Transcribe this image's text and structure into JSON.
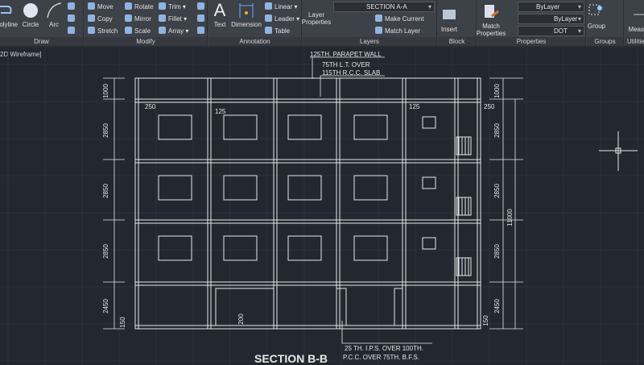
{
  "ribbon": {
    "draw": {
      "label": "Draw",
      "polyline": "Polyline",
      "circle": "Circle",
      "arc": "Arc"
    },
    "modify": {
      "label": "Modify",
      "move": "Move",
      "rotate": "Rotate",
      "trim": "Trim",
      "copy": "Copy",
      "mirror": "Mirror",
      "fillet": "Fillet",
      "stretch": "Stretch",
      "scale": "Scale",
      "array": "Array"
    },
    "annotation": {
      "label": "Annotation",
      "text": "Text",
      "dimension": "Dimension",
      "linear": "Linear",
      "leader": "Leader",
      "table": "Table"
    },
    "layers": {
      "label": "Layers",
      "layer_properties": "Layer Properties",
      "current_layer": "SECTION A-A",
      "make_current": "Make Current",
      "match_layer": "Match Layer"
    },
    "block": {
      "label": "Block",
      "insert": "Insert"
    },
    "properties": {
      "label": "Properties",
      "match_properties": "Match Properties",
      "color": "ByLayer",
      "lineweight": "ByLayer",
      "linetype": "DOT"
    },
    "groups": {
      "label": "Groups",
      "group": "Group"
    },
    "utilities": {
      "label": "Utilities",
      "measure": "Measure"
    }
  },
  "viewport": {
    "label": "2D Wireframe]"
  },
  "drawing": {
    "parapet_note": "125TH. PARAPET WALL",
    "slab_note_1": "75TH L.T. OVER",
    "slab_note_2": "115TH R.C.C. SLAB",
    "dim_250": "250",
    "dim_125": "125",
    "dim_1000": "1000",
    "dim_2850": "2850",
    "dim_2450": "2450",
    "dim_150": "150",
    "dim_200": "200",
    "dim_11000": "11000",
    "floor_note_1": "25 TH. I.P.S. OVER 100TH.",
    "floor_note_2": "P.C.C. OVER 75TH. B.F.S.",
    "title": "SECTION B-B"
  },
  "colors": {
    "background": "#212830",
    "ribbon": "#3d4148",
    "lines": "#e8e8e8"
  }
}
